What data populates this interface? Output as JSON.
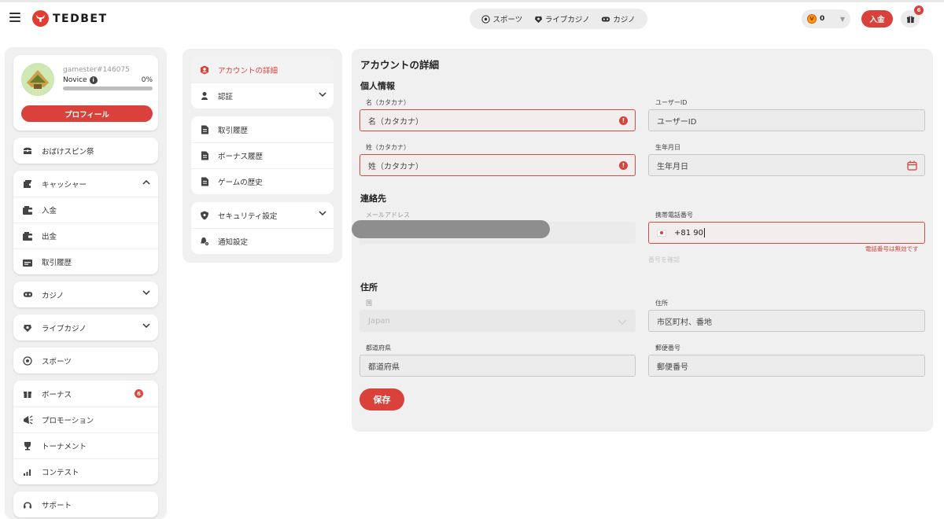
{
  "header": {
    "logo_text": "TEDBET",
    "nav": [
      {
        "label": "スポーツ",
        "icon": "soccer-ball-icon"
      },
      {
        "label": "ライブカジノ",
        "icon": "live-casino-icon"
      },
      {
        "label": "カジノ",
        "icon": "casino-icon"
      }
    ],
    "wallet_amount": "0",
    "deposit_label": "入金",
    "gift_badge_count": "6",
    "colors": {
      "accent": "#d9413a"
    }
  },
  "profile": {
    "username": "gamester#146075",
    "level": "Novice",
    "progress_text": "0%",
    "progress_value": 0.0,
    "profile_button": "プロフィール"
  },
  "sidebar": {
    "promo_item": "おばけスピン祭",
    "cashier": {
      "label": "キャッシャー",
      "items": [
        "入金",
        "出金",
        "取引履歴"
      ]
    },
    "casino": "カジノ",
    "live_casino": "ライブカジノ",
    "sports": "スポーツ",
    "bonus_group": {
      "bonus": "ボーナス",
      "bonus_badge": "6",
      "promotion": "プロモーション",
      "tournament": "トーナメント",
      "contest": "コンテスト"
    },
    "support": "サポート"
  },
  "menu": {
    "account_details": "アカウントの詳細",
    "verification": "認証",
    "transaction_history": "取引履歴",
    "bonus_history": "ボーナス履歴",
    "game_history": "ゲームの歴史",
    "security_settings": "セキュリティ設定",
    "notification_settings": "通知設定"
  },
  "form": {
    "title": "アカウントの詳細",
    "personal_section": "個人情報",
    "first_name_label": "名（カタカナ）",
    "first_name_placeholder": "名（カタカナ）",
    "user_id_label": "ユーザーID",
    "user_id_placeholder": "ユーザーID",
    "last_name_label": "姓（カタカナ）",
    "last_name_placeholder": "姓（カタカナ）",
    "birth_label": "生年月日",
    "birth_placeholder": "生年月日",
    "contact_section": "連絡先",
    "email_label": "メールアドレス",
    "phone_label": "携帯電話番号",
    "phone_value": "+81 90",
    "phone_error": "電話番号は無効です",
    "verify_number": "番号を確認",
    "address_section": "住所",
    "country_label": "国",
    "country_value": "Japan",
    "address_label": "住所",
    "address_placeholder": "市区町村、番地",
    "prefecture_label": "都道府県",
    "prefecture_placeholder": "都道府県",
    "postal_label": "郵便番号",
    "postal_placeholder": "郵便番号",
    "save_button": "保存"
  }
}
